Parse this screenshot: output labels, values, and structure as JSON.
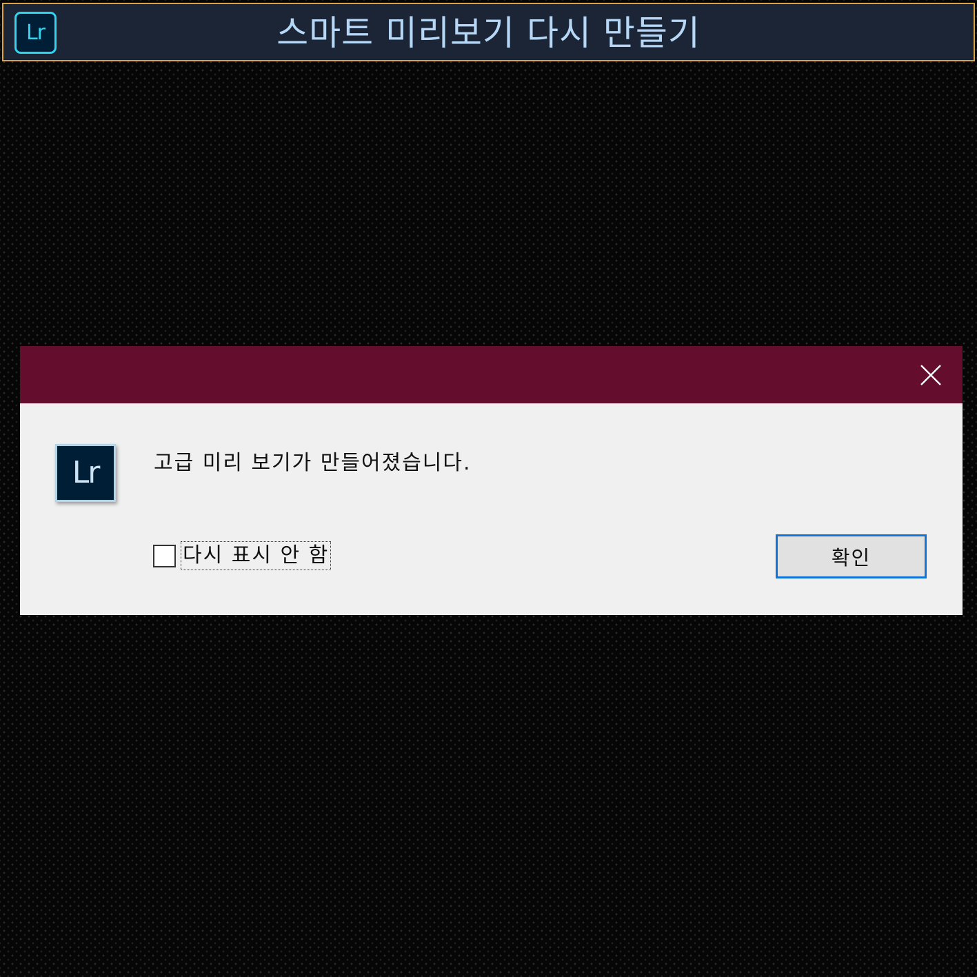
{
  "banner": {
    "logo_text": "Lr",
    "title": "스마트 미리보기 다시 만들기"
  },
  "dialog": {
    "icon_text": "Lr",
    "message": "고급 미리 보기가 만들어졌습니다.",
    "checkbox_label": "다시 표시 안 함",
    "checkbox_checked": false,
    "ok_label": "확인",
    "colors": {
      "titlebar": "#640d2c",
      "body": "#f0f0f0",
      "ok_border": "#0f73d8"
    }
  }
}
